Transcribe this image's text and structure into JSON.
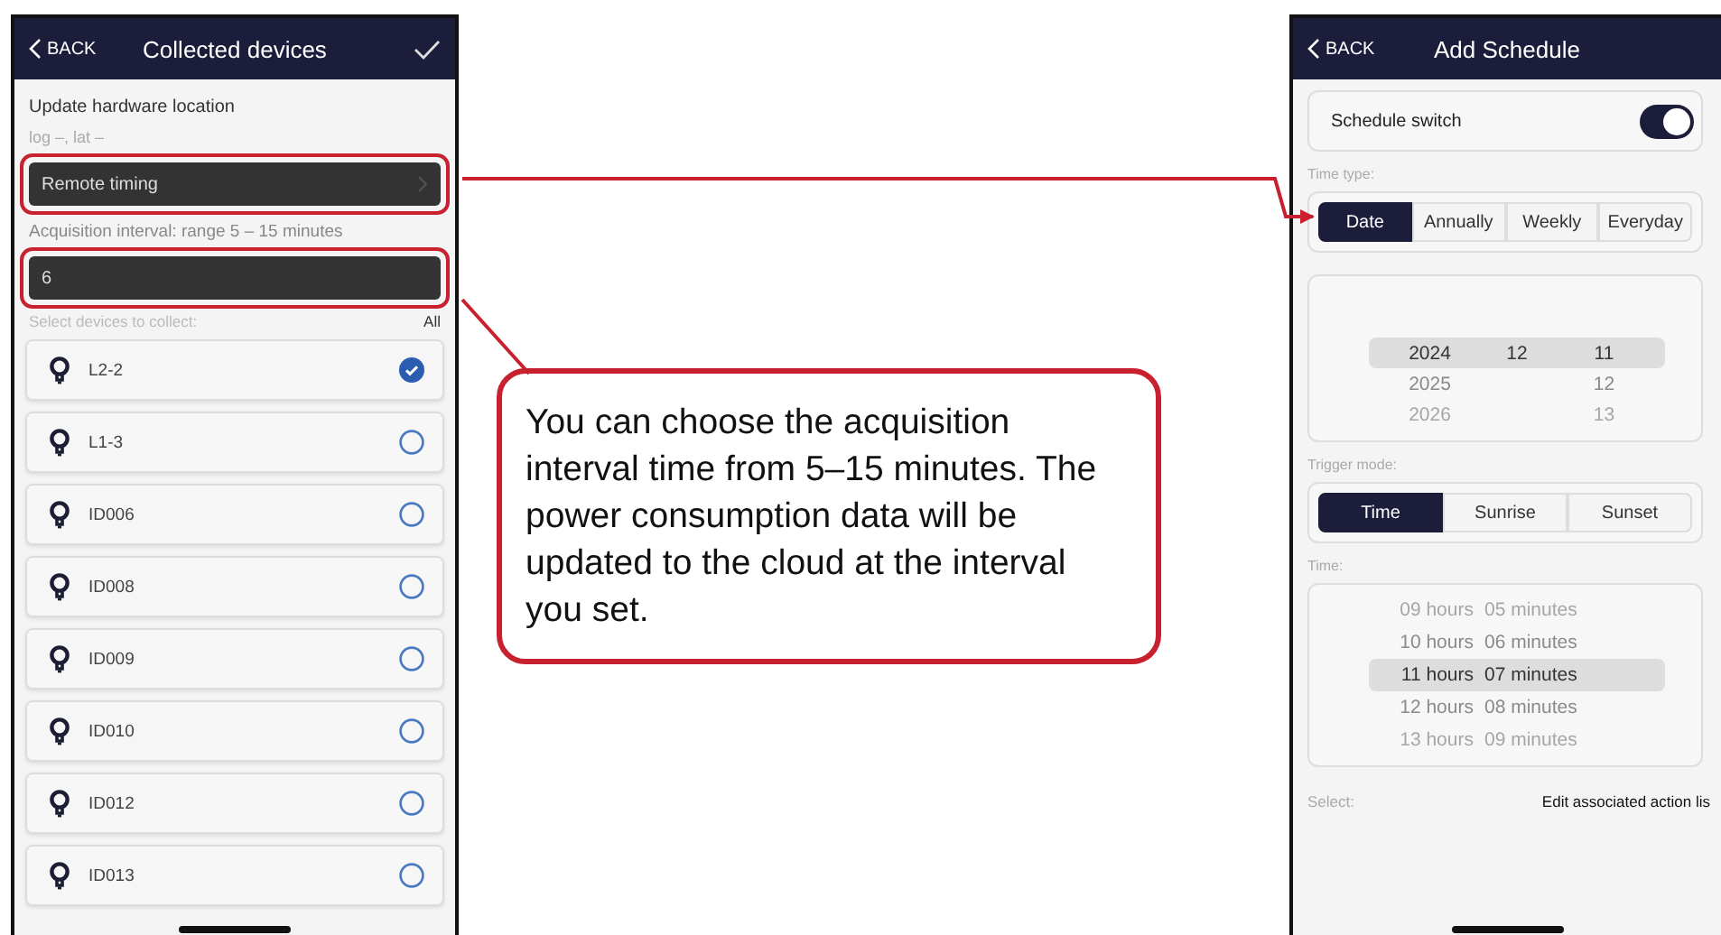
{
  "left_phone": {
    "back": "BACK",
    "title": "Collected devices",
    "section_title": "Update hardware location",
    "location": "log –, lat –",
    "remote_timing": "Remote timing",
    "interval_label": "Acquisition interval: range 5 – 15 minutes",
    "interval_value": "6",
    "select_label": "Select devices to collect:",
    "select_all": "All",
    "devices": [
      {
        "name": "L2-2",
        "selected": true
      },
      {
        "name": "L1-3",
        "selected": false
      },
      {
        "name": "ID006",
        "selected": false
      },
      {
        "name": "ID008",
        "selected": false
      },
      {
        "name": "ID009",
        "selected": false
      },
      {
        "name": "ID010",
        "selected": false
      },
      {
        "name": "ID012",
        "selected": false
      },
      {
        "name": "ID013",
        "selected": false
      }
    ]
  },
  "callout": {
    "text": "You can choose the acquisition interval time from 5–15 minutes. The power consumption data will be updated to the cloud at the interval you set."
  },
  "right_phone": {
    "back": "BACK",
    "title": "Add Schedule",
    "switch_label": "Schedule switch",
    "switch_on": true,
    "time_type_label": "Time type:",
    "time_types": [
      {
        "label": "Date",
        "selected": true
      },
      {
        "label": "Annually",
        "selected": false
      },
      {
        "label": "Weekly",
        "selected": false
      },
      {
        "label": "Everyday",
        "selected": false
      }
    ],
    "date_rows": [
      {
        "year": "2024",
        "month": "12",
        "day": "11",
        "selected": true
      },
      {
        "year": "2025",
        "day": "12",
        "selected": false
      },
      {
        "year": "2026",
        "day": "13",
        "selected": false
      }
    ],
    "trigger_label": "Trigger mode:",
    "trigger_modes": [
      {
        "label": "Time",
        "selected": true
      },
      {
        "label": "Sunrise",
        "selected": false
      },
      {
        "label": "Sunset",
        "selected": false
      }
    ],
    "time_label": "Time:",
    "time_rows": [
      {
        "hours": "09 hours",
        "minutes": "05 minutes",
        "selected": false
      },
      {
        "hours": "10 hours",
        "minutes": "06 minutes",
        "selected": false
      },
      {
        "hours": "11 hours",
        "minutes": "07 minutes",
        "selected": true
      },
      {
        "hours": "12 hours",
        "minutes": "08 minutes",
        "selected": false
      },
      {
        "hours": "13 hours",
        "minutes": "09 minutes",
        "selected": false
      }
    ],
    "select_label": "Select:",
    "edit_link": "Edit associated action lis"
  }
}
